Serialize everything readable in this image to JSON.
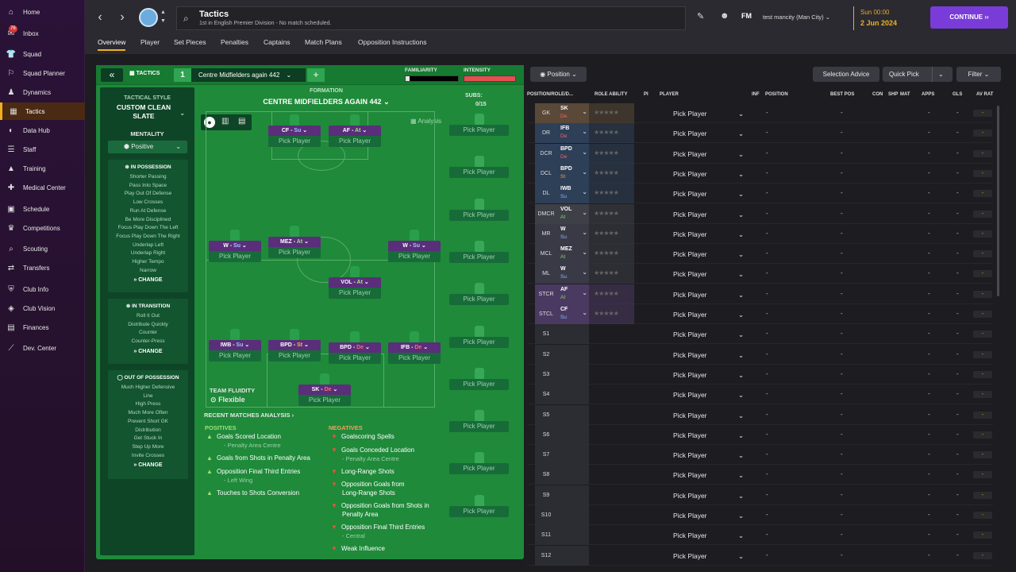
{
  "sidebar": {
    "items": [
      {
        "label": "Home",
        "icon": "home-icon"
      },
      {
        "label": "Inbox",
        "icon": "inbox-icon",
        "badge": "76"
      },
      {
        "label": "Squad",
        "icon": "shirt-icon"
      },
      {
        "label": "Squad Planner",
        "icon": "planner-icon"
      },
      {
        "label": "Dynamics",
        "icon": "dynamics-icon"
      },
      {
        "label": "Tactics",
        "icon": "tactics-icon"
      },
      {
        "label": "Data Hub",
        "icon": "datahub-icon"
      },
      {
        "label": "Staff",
        "icon": "staff-icon"
      },
      {
        "label": "Training",
        "icon": "training-icon"
      },
      {
        "label": "Medical Center",
        "icon": "medical-icon"
      },
      {
        "label": "Schedule",
        "icon": "calendar-icon"
      },
      {
        "label": "Competitions",
        "icon": "trophy-icon"
      },
      {
        "label": "Scouting",
        "icon": "scouting-icon"
      },
      {
        "label": "Transfers",
        "icon": "transfers-icon"
      },
      {
        "label": "Club Info",
        "icon": "club-icon"
      },
      {
        "label": "Club Vision",
        "icon": "vision-icon"
      },
      {
        "label": "Finances",
        "icon": "finances-icon"
      },
      {
        "label": "Dev. Center",
        "icon": "devcenter-icon"
      }
    ]
  },
  "header": {
    "title": "Tactics",
    "subtitle": "1st in English Premier Division - No match scheduled.",
    "fm": "FM",
    "manager": "test mancity (Man City)",
    "day": "Sun 00:00",
    "date": "2 Jun 2024",
    "continue": "CONTINUE",
    "continue_badge": "2"
  },
  "tabs": [
    "Overview",
    "Player",
    "Set Pieces",
    "Penalties",
    "Captains",
    "Match Plans",
    "Opposition Instructions"
  ],
  "tactic": {
    "label": "TACTICS",
    "slot": "1",
    "name": "Centre Midfielders again 442",
    "familiarity": "FAMILIARITY",
    "intensity": "INTENSITY",
    "style_label": "TACTICAL STYLE",
    "style": "CUSTOM CLEAN SLATE",
    "mentality_label": "MENTALITY",
    "mentality": "Positive",
    "formation_label": "FORMATION",
    "formation": "CENTRE MIDFIELDERS AGAIN 442",
    "subs_label": "SUBS:",
    "subs": "0/15",
    "analysis": "Analysis",
    "fluidity_label": "TEAM FLUIDITY",
    "fluidity": "Flexible",
    "change": "CHANGE",
    "pick": "Pick Player"
  },
  "in_possession": {
    "title": "IN POSSESSION",
    "lines": [
      "Shorter Passing",
      "Pass Into Space",
      "Play Out Of Defense",
      "Low Crosses",
      "Run At Defense",
      "Be More Disciplined",
      "Focus Play Down The Left",
      "Focus Play Down The Right",
      "Underlap Left",
      "Underlap Right",
      "Higher Tempo",
      "Narrow"
    ]
  },
  "in_transition": {
    "title": "IN TRANSITION",
    "lines": [
      "Roll It Out",
      "Distribute Quickly",
      "Counter",
      "Counter-Press"
    ]
  },
  "out_possession": {
    "title": "OUT OF POSSESSION",
    "lines": [
      "Much Higher Defensive",
      "Line",
      "High Press",
      "Much More Often",
      "Prevent Short GK",
      "Distribution",
      "Get Stuck In",
      "Step Up More",
      "Invite Crosses"
    ]
  },
  "players": [
    {
      "role": "CF",
      "duty": "Su"
    },
    {
      "role": "AF",
      "duty": "At"
    },
    {
      "role": "W",
      "duty": "Su"
    },
    {
      "role": "MEZ",
      "duty": "At"
    },
    {
      "role": "W",
      "duty": "Su"
    },
    {
      "role": "VOL",
      "duty": "At"
    },
    {
      "role": "IWB",
      "duty": "Su"
    },
    {
      "role": "BPD",
      "duty": "St"
    },
    {
      "role": "BPD",
      "duty": "De"
    },
    {
      "role": "IFB",
      "duty": "De"
    },
    {
      "role": "SK",
      "duty": "De"
    }
  ],
  "analysis": {
    "title": "RECENT MATCHES ANALYSIS",
    "positives_label": "POSITIVES",
    "negatives_label": "NEGATIVES",
    "positives": [
      [
        "Goals Scored Location",
        "- Penalty Area Centre"
      ],
      [
        "Goals from Shots in Penalty Area",
        ""
      ],
      [
        "Opposition Final Third Entries",
        "- Left Wing"
      ],
      [
        "Touches to Shots Conversion",
        ""
      ]
    ],
    "negatives": [
      [
        "Goalscoring Spells",
        ""
      ],
      [
        "Goals Conceded Location",
        "- Penalty Area Centre"
      ],
      [
        "Long-Range Shots",
        ""
      ],
      [
        "Opposition Goals from",
        "Long-Range Shots"
      ],
      [
        "Opposition Goals from Shots in",
        "Penalty Area"
      ],
      [
        "Opposition Final Third Entries",
        "- Central"
      ],
      [
        "Weak Influence",
        ""
      ]
    ]
  },
  "right": {
    "position_btn": "Position",
    "selection_advice": "Selection Advice",
    "quick_pick": "Quick Pick",
    "filter": "Filter",
    "headers": [
      "POSITION/ROLE/D...",
      "ROLE ABILITY",
      "PI",
      "PLAYER",
      "INF",
      "POSITION",
      "BEST POS",
      "CON",
      "SHP",
      "MAT",
      "APPS",
      "GLS",
      "AV RAT"
    ],
    "rows": [
      {
        "pos": "GK",
        "role": "SK",
        "duty": "De"
      },
      {
        "pos": "DR",
        "role": "IFB",
        "duty": "De"
      },
      {
        "pos": "DCR",
        "role": "BPD",
        "duty": "De"
      },
      {
        "pos": "DCL",
        "role": "BPD",
        "duty": "St"
      },
      {
        "pos": "DL",
        "role": "IWB",
        "duty": "Su"
      },
      {
        "pos": "DMCR",
        "role": "VOL",
        "duty": "At"
      },
      {
        "pos": "MR",
        "role": "W",
        "duty": "Su"
      },
      {
        "pos": "MCL",
        "role": "MEZ",
        "duty": "At"
      },
      {
        "pos": "ML",
        "role": "W",
        "duty": "Su"
      },
      {
        "pos": "STCR",
        "role": "AF",
        "duty": "At"
      },
      {
        "pos": "STCL",
        "role": "CF",
        "duty": "Su"
      },
      {
        "pos": "S1"
      },
      {
        "pos": "S2"
      },
      {
        "pos": "S3"
      },
      {
        "pos": "S4"
      },
      {
        "pos": "S5"
      },
      {
        "pos": "S6"
      },
      {
        "pos": "S7"
      },
      {
        "pos": "S8"
      },
      {
        "pos": "S9"
      },
      {
        "pos": "S10"
      },
      {
        "pos": "S11"
      },
      {
        "pos": "S12"
      }
    ],
    "dash": "-"
  },
  "colors": {
    "accent": "#f0b020",
    "continue": "#7a3cd8",
    "pitch": "#1f8a3a"
  }
}
